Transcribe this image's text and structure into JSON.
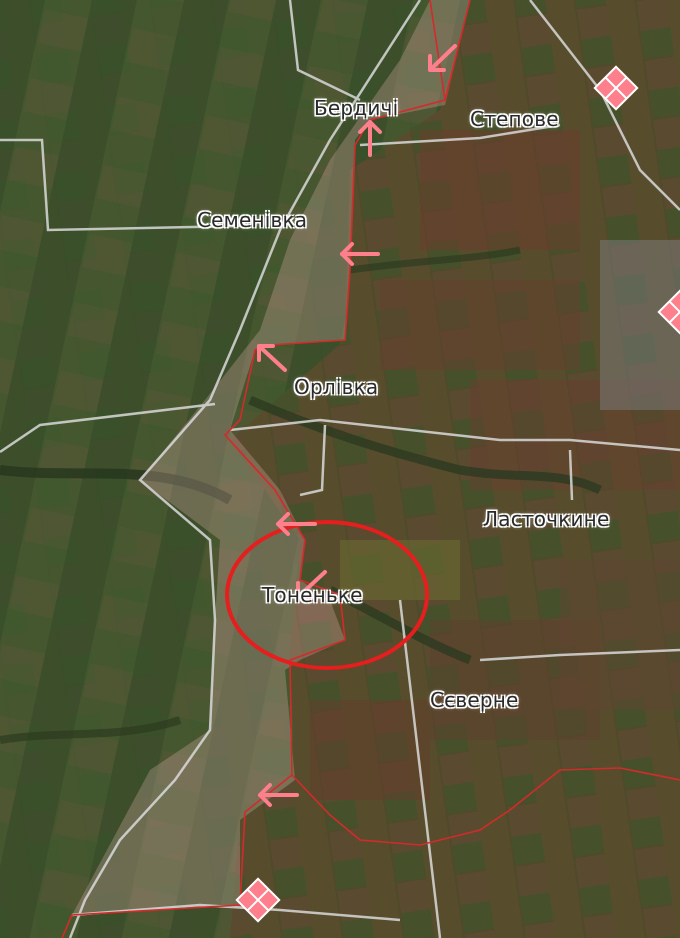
{
  "map": {
    "places": [
      {
        "id": "berdychi",
        "name": "Бердичі"
      },
      {
        "id": "stepove",
        "name": "Степове"
      },
      {
        "id": "semenivka",
        "name": "Семенівка"
      },
      {
        "id": "orlivka",
        "name": "Орлівка"
      },
      {
        "id": "lastochkyne",
        "name": "Ласточкине"
      },
      {
        "id": "tonenke",
        "name": "Тоненьке"
      },
      {
        "id": "siverne",
        "name": "Сєверне"
      }
    ],
    "colors": {
      "front_line": "#d42a2a",
      "occupied_tint": "#e9b8b8",
      "arrow": "#ff7f8c",
      "highlight_circle": "#e51e1e",
      "road": "#d9d9d9",
      "military_marker": "#ff7f8c"
    },
    "icons": [
      "advance-arrow-icon",
      "military-unit-marker-icon"
    ]
  }
}
